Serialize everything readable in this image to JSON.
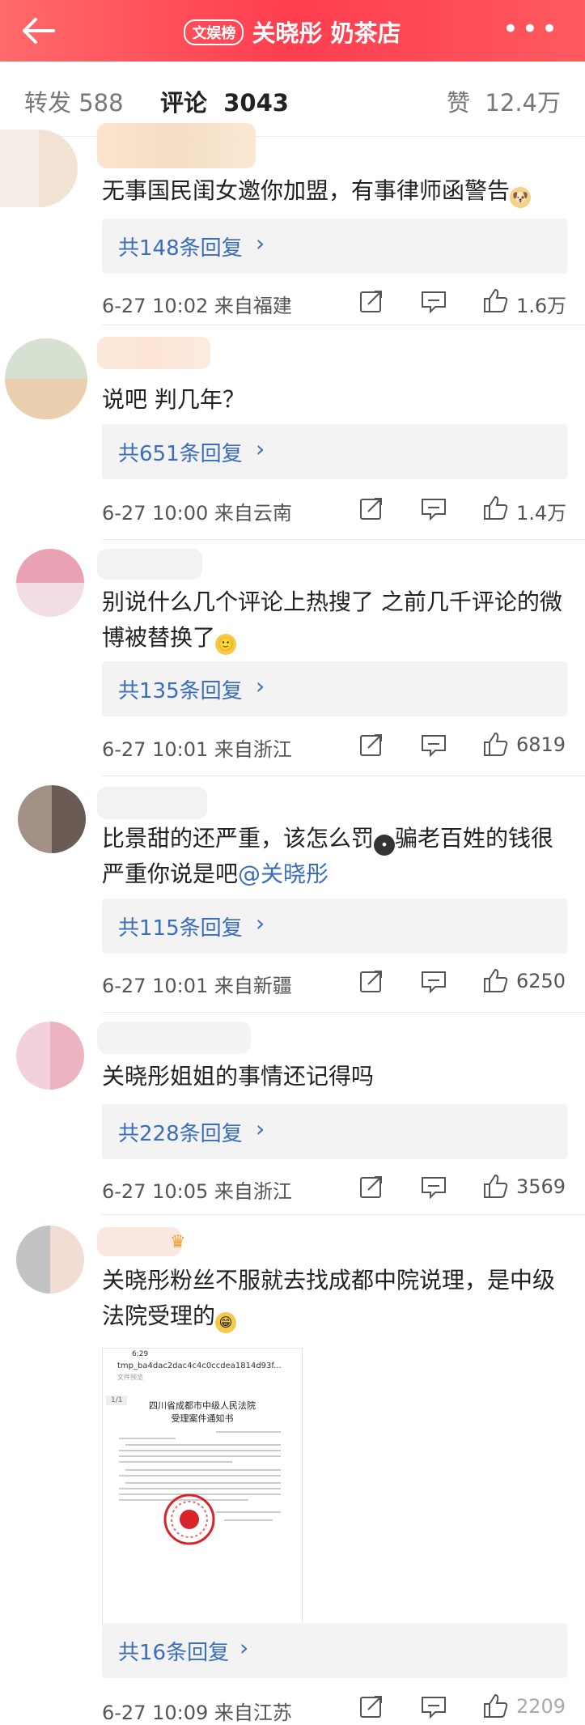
{
  "header": {
    "badge": "文娱榜",
    "title": "关晓彤 奶茶店",
    "more": "•••"
  },
  "tabs": {
    "repost_label": "转发",
    "repost_count": "588",
    "comment_label": "评论",
    "comment_count": "3043",
    "like_label": "赞",
    "like_count": "12.4万"
  },
  "comments": [
    {
      "text": "无事国民闺女邀你加盟，有事律师函警告",
      "emoji": "doge",
      "replies": "共148条回复",
      "time": "6-27 10:02",
      "location": "来自福建",
      "likes": "1.6万"
    },
    {
      "text": "说吧 判几年？",
      "replies": "共651条回复",
      "time": "6-27 10:00",
      "location": "来自云南",
      "likes": "1.4万"
    },
    {
      "text": "别说什么几个评论上热搜了 之前几千评论的微博被替换了",
      "emoji": "smile",
      "replies": "共135条回复",
      "time": "6-27 10:01",
      "location": "来自浙江",
      "likes": "6819"
    },
    {
      "text_before": "比景甜的还严重，该怎么罚",
      "text_after": "骗老百姓的钱很严重你说是吧",
      "mention": "@关晓彤",
      "emoji": "black-face",
      "replies": "共115条回复",
      "time": "6-27 10:01",
      "location": "来自新疆",
      "likes": "6250"
    },
    {
      "text": "关晓彤姐姐的事情还记得吗",
      "replies": "共228条回复",
      "time": "6-27 10:05",
      "location": "来自浙江",
      "likes": "3569"
    },
    {
      "text": "关晓彤粉丝不服就去找成都中院说理，是中级法院受理的",
      "emoji": "grin",
      "replies": "共16条回复",
      "time": "6-27 10:09",
      "location": "来自江苏",
      "likes": "2209"
    }
  ],
  "document_image": {
    "time": "6:29",
    "filename": "tmp_ba4dac2dac4c4c0ccdea1814d93f...",
    "subtitle": "文件预览",
    "page": "1/1",
    "court": "四川省成都市中级人民法院",
    "doc_title": "受理案件通知书"
  },
  "colors": {
    "header": "#ff3d4f",
    "link": "#3a6dbb",
    "reply_bg": "#f3f3f3"
  }
}
